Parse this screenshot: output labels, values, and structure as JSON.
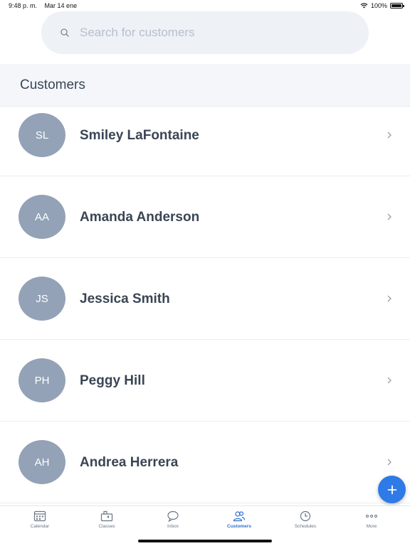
{
  "status": {
    "time": "9:48 p. m.",
    "date": "Mar 14 ene",
    "battery": "100%"
  },
  "search": {
    "placeholder": "Search for customers"
  },
  "section": {
    "title": "Customers"
  },
  "customers": [
    {
      "initials": "SL",
      "name": "Smiley LaFontaine"
    },
    {
      "initials": "AA",
      "name": "Amanda Anderson"
    },
    {
      "initials": "JS",
      "name": "Jessica Smith"
    },
    {
      "initials": "PH",
      "name": "Peggy Hill"
    },
    {
      "initials": "AH",
      "name": "Andrea Herrera"
    }
  ],
  "fab": {
    "icon": "plus-icon"
  },
  "tabs": [
    {
      "label": "Calendar",
      "icon": "calendar-icon"
    },
    {
      "label": "Classes",
      "icon": "classes-icon"
    },
    {
      "label": "Inbox",
      "icon": "chat-bubbles-icon"
    },
    {
      "label": "Customers",
      "icon": "people-icon",
      "active": true
    },
    {
      "label": "Schedules",
      "icon": "clock-icon"
    },
    {
      "label": "More",
      "icon": "more-dots-icon"
    }
  ],
  "colors": {
    "accent": "#2e7ae6",
    "avatar": "#93a2b6",
    "text": "#3a4555",
    "inactive": "#6b7585"
  }
}
